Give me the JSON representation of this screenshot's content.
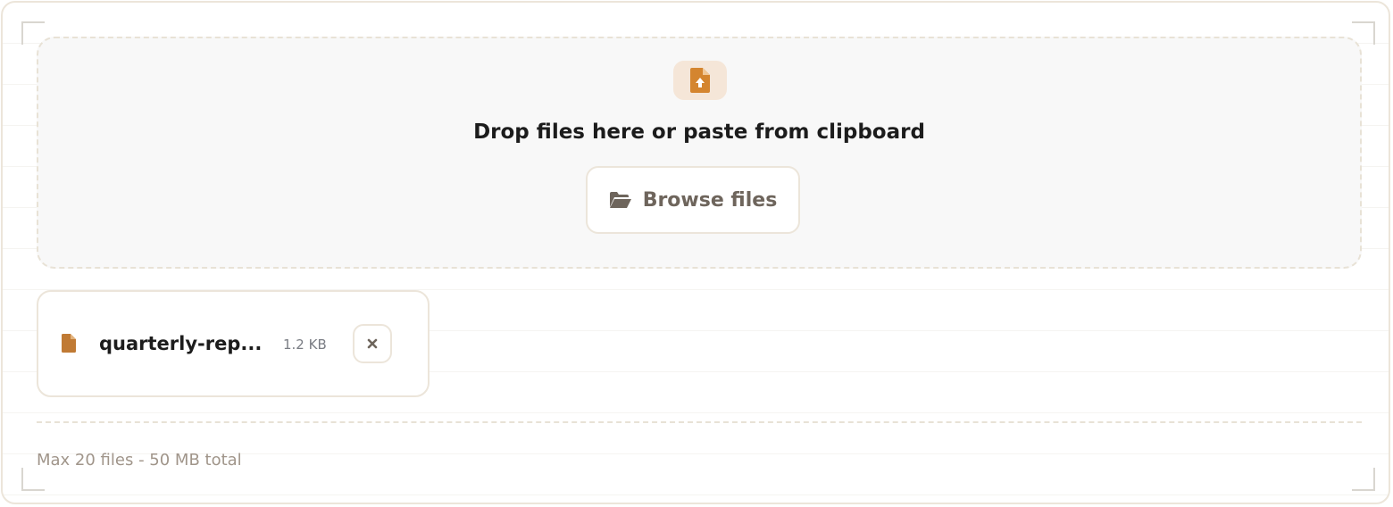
{
  "dropzone": {
    "title": "Drop files here or paste from clipboard",
    "upload_icon": "file-upload-icon",
    "browse_label": "Browse files",
    "browse_icon": "folder-open-icon"
  },
  "files": [
    {
      "name": "quarterly-rep...",
      "size": "1.2 KB",
      "icon": "file-icon",
      "remove_icon": "close-icon"
    }
  ],
  "footer": {
    "limits": "Max 20 files - 50 MB total"
  },
  "colors": {
    "accent": "#d4852f",
    "accent_soft": "#f5e6d8",
    "border": "#ece5da",
    "text_primary": "#1c1c1c",
    "text_muted": "#a0958a"
  }
}
